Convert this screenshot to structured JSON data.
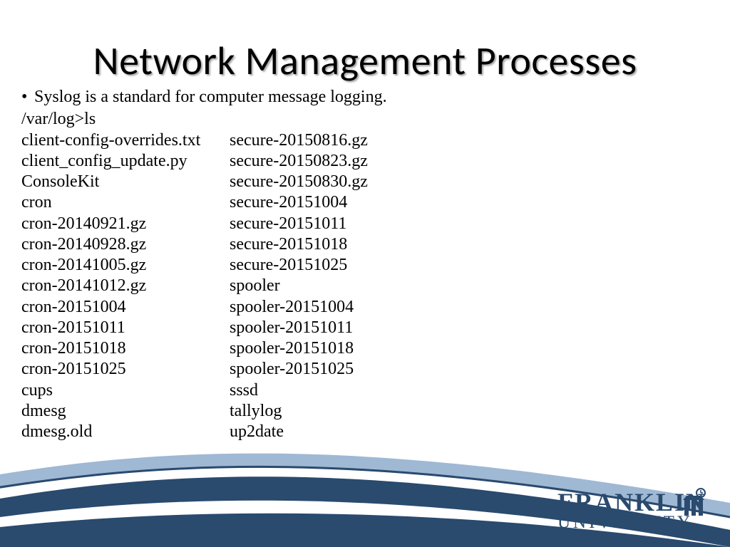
{
  "title": "Network Management Processes",
  "bullet": "Syslog is a standard for computer message logging.",
  "command": "/var/log>ls",
  "listing": [
    [
      "client-config-overrides.txt",
      "secure-20150816.gz"
    ],
    [
      "client_config_update.py",
      "secure-20150823.gz"
    ],
    [
      "ConsoleKit",
      "secure-20150830.gz"
    ],
    [
      "cron",
      "secure-20151004"
    ],
    [
      "cron-20140921.gz",
      "secure-20151011"
    ],
    [
      "cron-20140928.gz",
      "secure-20151018"
    ],
    [
      "cron-20141005.gz",
      "secure-20151025"
    ],
    [
      "cron-20141012.gz",
      "spooler"
    ],
    [
      "cron-20151004",
      "spooler-20151004"
    ],
    [
      "cron-20151011",
      "spooler-20151011"
    ],
    [
      "cron-20151018",
      "spooler-20151018"
    ],
    [
      "cron-20151025",
      "spooler-20151025"
    ],
    [
      "cups",
      "sssd"
    ],
    [
      "dmesg",
      "tallylog"
    ],
    [
      "dmesg.old",
      "up2date"
    ]
  ],
  "logo": {
    "line1": "FRANKLIN",
    "line2": "UNIVERSITY"
  },
  "colors": {
    "brand_blue": "#2a4a6e",
    "light_blue": "#9fb8d4"
  }
}
